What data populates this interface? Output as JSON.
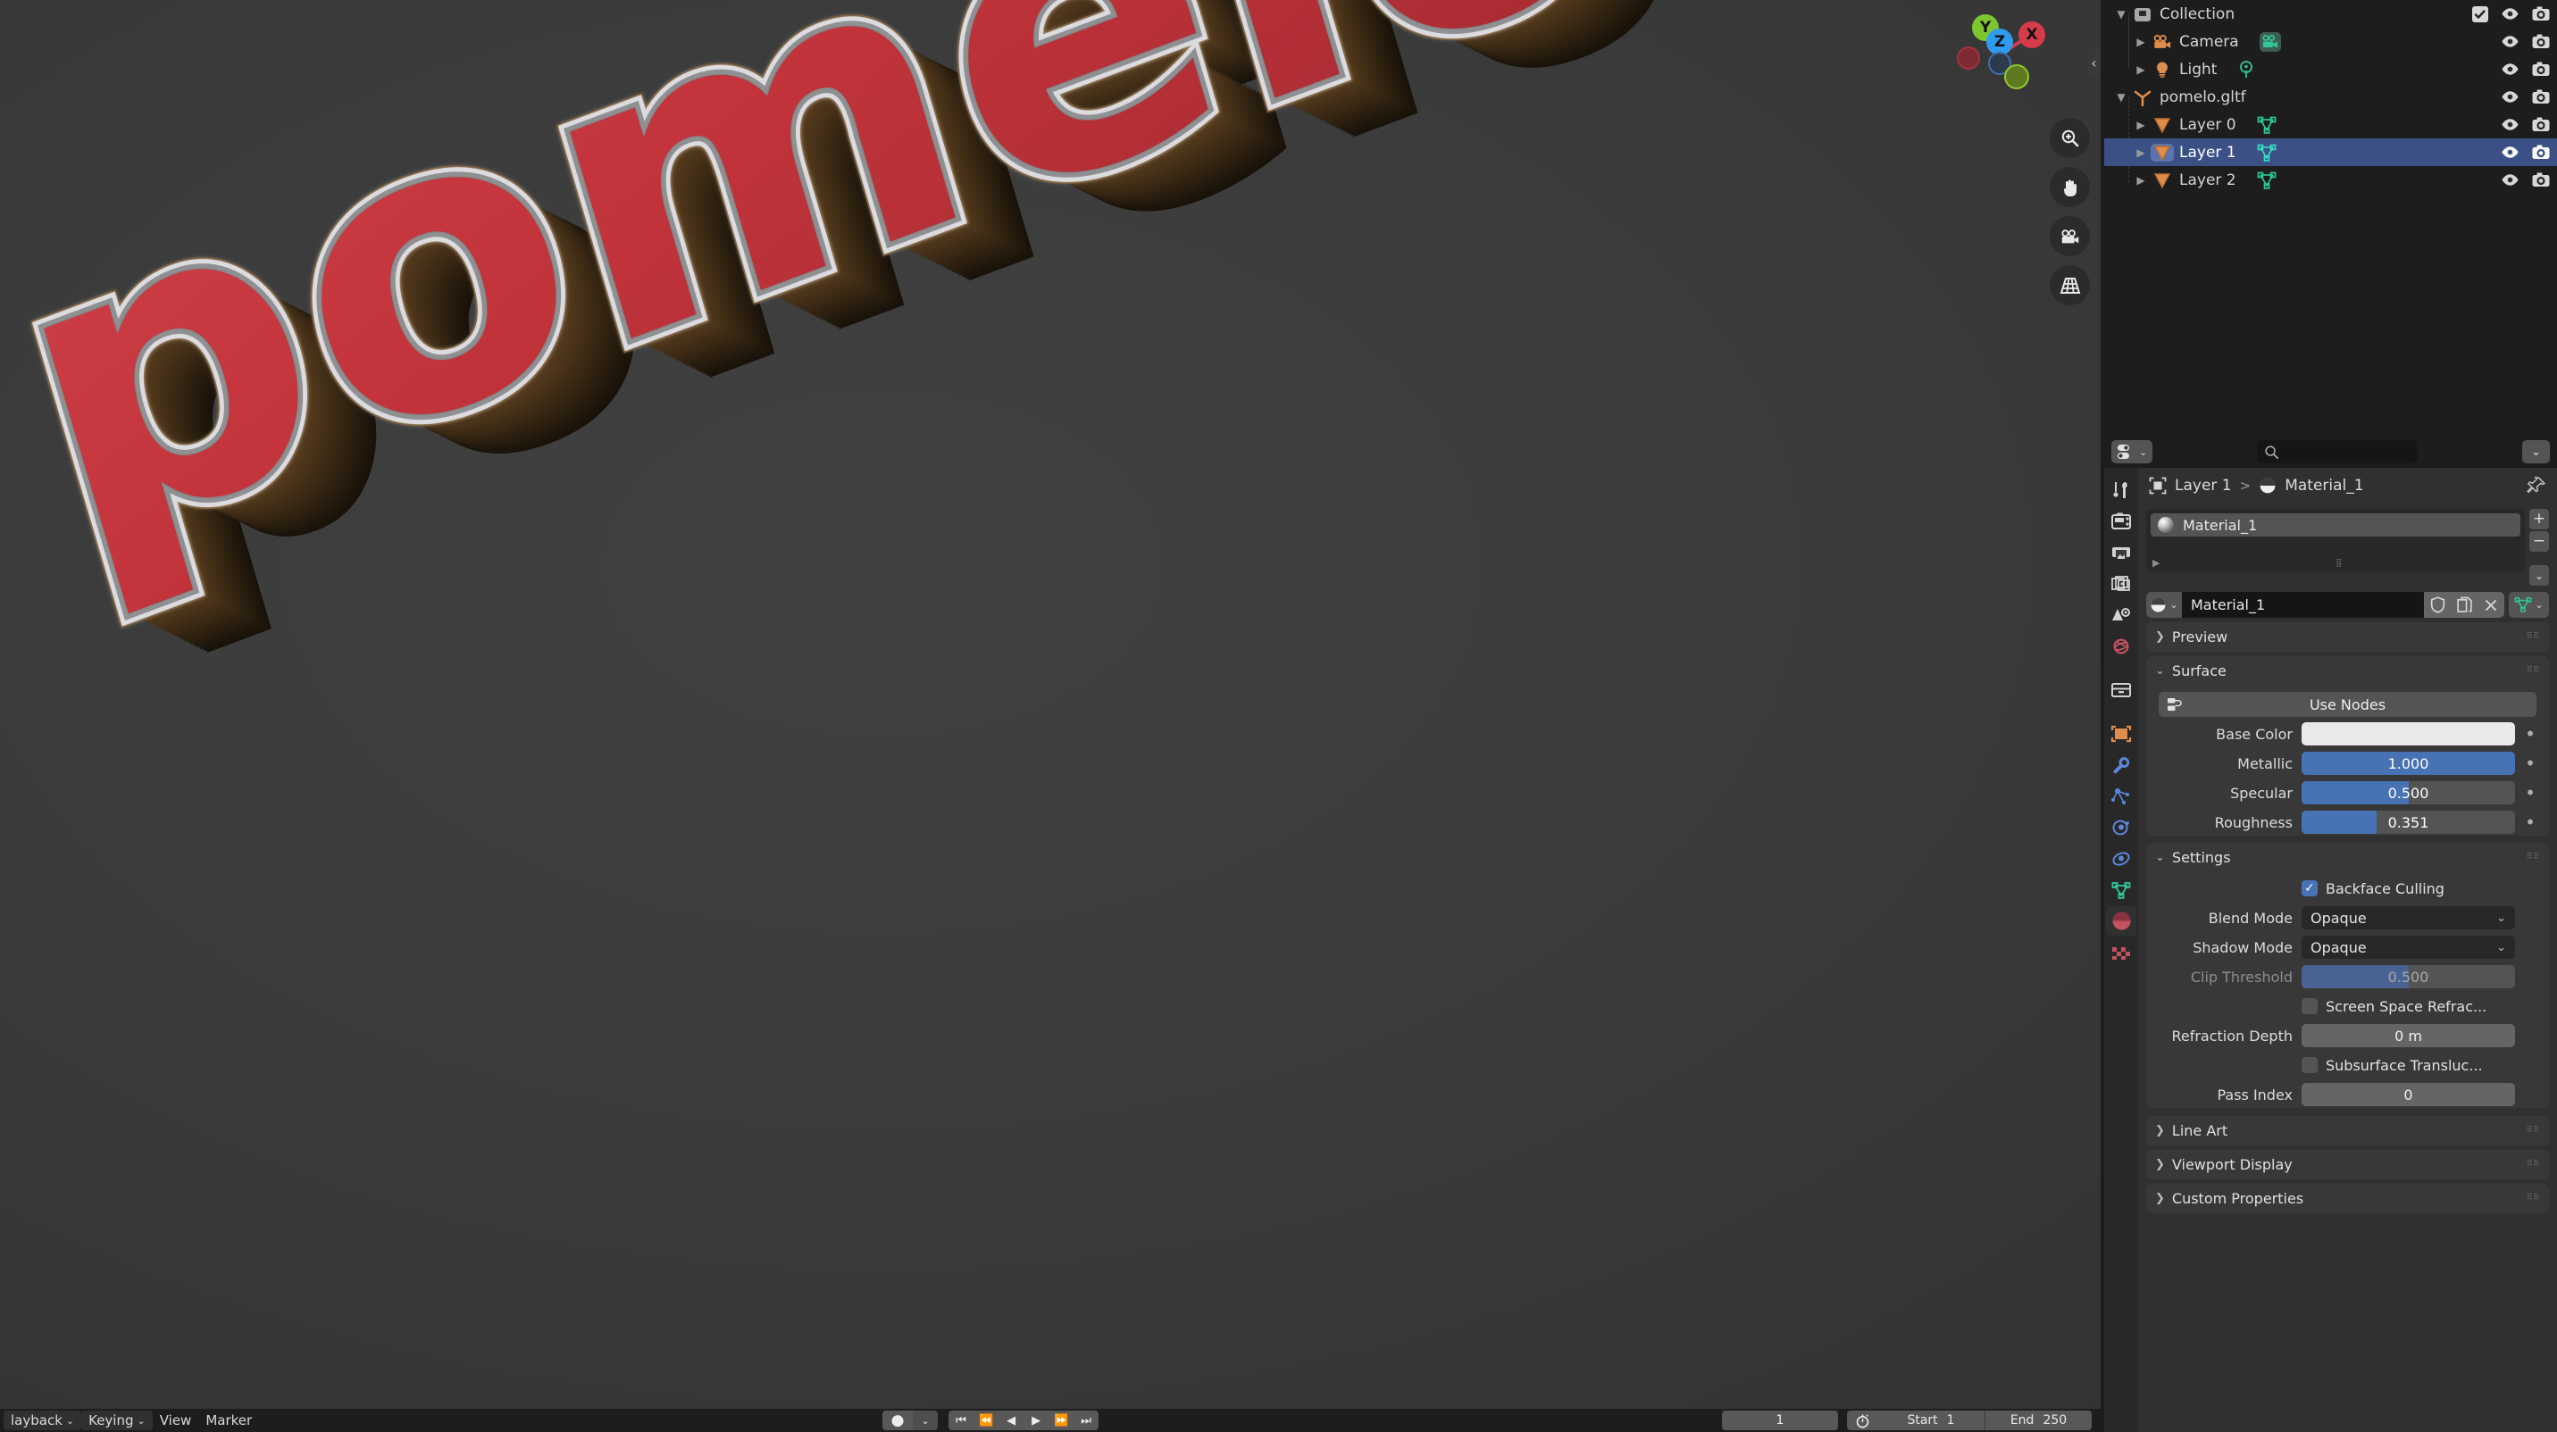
{
  "viewport": {
    "scene_text": "pomelo",
    "gizmo": {
      "axes": [
        {
          "label": "Y",
          "color": "#7dc62f"
        },
        {
          "label": "Z",
          "color": "#2e9bf0"
        },
        {
          "label": "X",
          "color": "#d63b4a"
        }
      ]
    },
    "tools": [
      {
        "name": "zoom-tool",
        "glyph": "zoom-icon"
      },
      {
        "name": "pan-tool",
        "glyph": "hand-icon"
      },
      {
        "name": "camera-tool",
        "glyph": "camera-icon"
      },
      {
        "name": "ortho-persp-tool",
        "glyph": "grid-icon"
      }
    ],
    "sidebar_toggle": "‹"
  },
  "outliner": {
    "rows": [
      {
        "name": "Collection",
        "icon": "collection-icon",
        "depth": 0,
        "expanded": true,
        "selected": false,
        "has_checkbox": true,
        "data_icon": null
      },
      {
        "name": "Camera",
        "icon": "camera-object-icon",
        "depth": 1,
        "expanded": false,
        "selected": false,
        "has_checkbox": false,
        "data_icon": "camera-data-icon"
      },
      {
        "name": "Light",
        "icon": "light-object-icon",
        "depth": 1,
        "expanded": false,
        "selected": false,
        "has_checkbox": false,
        "data_icon": "light-data-icon"
      },
      {
        "name": "pomelo.gltf",
        "icon": "empty-axes-icon",
        "depth": 0,
        "expanded": true,
        "selected": false,
        "has_checkbox": false,
        "data_icon": null
      },
      {
        "name": "Layer 0",
        "icon": "mesh-object-icon",
        "depth": 1,
        "expanded": false,
        "selected": false,
        "has_checkbox": false,
        "data_icon": "mesh-data-icon"
      },
      {
        "name": "Layer 1",
        "icon": "mesh-object-icon",
        "depth": 1,
        "expanded": false,
        "selected": true,
        "has_checkbox": false,
        "data_icon": "mesh-data-icon"
      },
      {
        "name": "Layer 2",
        "icon": "mesh-object-icon",
        "depth": 1,
        "expanded": false,
        "selected": false,
        "has_checkbox": false,
        "data_icon": "mesh-data-icon"
      }
    ],
    "row_toggles": [
      "eye-icon",
      "camera-render-icon"
    ]
  },
  "properties": {
    "header": {
      "editor_type": "properties-editor-icon",
      "search_placeholder": "",
      "options_chevron": "⌄"
    },
    "tabs": [
      {
        "name": "tool",
        "icon": "tool-icon",
        "active": false
      },
      {
        "name": "render",
        "icon": "render-icon",
        "active": false
      },
      {
        "name": "output",
        "icon": "output-printer-icon",
        "active": false
      },
      {
        "name": "view-layer",
        "icon": "view-layer-images-icon",
        "active": false
      },
      {
        "name": "scene",
        "icon": "scene-cone-icon",
        "active": false
      },
      {
        "name": "world",
        "icon": "world-globe-icon",
        "active": false
      },
      {
        "name": "collection",
        "icon": "collection-box-icon",
        "active": false
      },
      {
        "name": "object",
        "icon": "object-square-icon",
        "active": false
      },
      {
        "name": "modifiers",
        "icon": "wrench-icon",
        "active": false
      },
      {
        "name": "particles",
        "icon": "particles-icon",
        "active": false
      },
      {
        "name": "physics",
        "icon": "physics-orbit-icon",
        "active": false
      },
      {
        "name": "constraints",
        "icon": "constraints-icon",
        "active": false
      },
      {
        "name": "object-data",
        "icon": "mesh-data-triangle-icon",
        "active": false
      },
      {
        "name": "material",
        "icon": "material-sphere-icon",
        "active": true
      },
      {
        "name": "texture",
        "icon": "texture-checker-icon",
        "active": false
      }
    ],
    "breadcrumb": {
      "object_icon": "object-icon",
      "object": "Layer 1",
      "separator": ">",
      "material_icon": "material-icon",
      "material": "Material_1",
      "pin_icon": "pin-icon"
    },
    "material_slots": {
      "items": [
        {
          "name": "Material_1",
          "selected": true
        }
      ],
      "add_label": "+",
      "remove_label": "−",
      "menu_label": "⌄",
      "specials_arrow": "▶"
    },
    "material_id": {
      "browse_icon": "material-browse-icon",
      "name": "Material_1",
      "buttons": [
        "shield-fake-user-icon",
        "copy-new-material-icon",
        "unlink-x-icon"
      ],
      "filter_icon": "mesh-filter-icon"
    },
    "panels": {
      "preview": {
        "label": "Preview",
        "expanded": false
      },
      "surface": {
        "label": "Surface",
        "expanded": true
      },
      "settings": {
        "label": "Settings",
        "expanded": true
      },
      "line_art": {
        "label": "Line Art",
        "expanded": false
      },
      "viewport_display": {
        "label": "Viewport Display",
        "expanded": false
      },
      "custom_properties": {
        "label": "Custom Properties",
        "expanded": false
      }
    },
    "surface": {
      "use_nodes_label": "Use Nodes",
      "use_nodes_icon": "nodes-icon",
      "fields": [
        {
          "label": "Base Color",
          "type": "color",
          "value": "#e9e9e9"
        },
        {
          "label": "Metallic",
          "type": "slider",
          "value": "1.000",
          "fill": 100
        },
        {
          "label": "Specular",
          "type": "slider",
          "value": "0.500",
          "fill": 50
        },
        {
          "label": "Roughness",
          "type": "slider",
          "value": "0.351",
          "fill": 35
        }
      ]
    },
    "settings": {
      "backface_culling": {
        "label": "Backface Culling",
        "checked": true
      },
      "blend_mode": {
        "label": "Blend Mode",
        "value": "Opaque"
      },
      "shadow_mode": {
        "label": "Shadow Mode",
        "value": "Opaque"
      },
      "clip_threshold": {
        "label": "Clip Threshold",
        "value": "0.500",
        "fill": 50,
        "disabled": true
      },
      "screen_space_refraction": {
        "label": "Screen Space Refrac...",
        "checked": false
      },
      "refraction_depth": {
        "label": "Refraction Depth",
        "value": "0 m"
      },
      "subsurface_translucency": {
        "label": "Subsurface Transluc...",
        "checked": false
      },
      "pass_index": {
        "label": "Pass Index",
        "value": "0"
      }
    }
  },
  "timeline": {
    "menus": [
      {
        "label": "layback",
        "chevron": "⌄",
        "boxed": true
      },
      {
        "label": "Keying",
        "chevron": "⌄",
        "boxed": true
      },
      {
        "label": "View",
        "chevron": "",
        "boxed": false
      },
      {
        "label": "Marker",
        "chevron": "",
        "boxed": false
      }
    ],
    "record_button": "●",
    "record_chevron": "⌄",
    "transport": [
      "⏮",
      "⏪",
      "◀",
      "▶",
      "⏩",
      "⏭"
    ],
    "current_frame": "1",
    "timer_icon": "stopwatch-icon",
    "start_label": "Start",
    "start_value": "1",
    "end_label": "End",
    "end_value": "250"
  },
  "colors": {
    "accent_blue": "#4772b3",
    "selection_blue": "#3b5185",
    "panel_bg": "#383838",
    "editor_bg": "#303030",
    "header_bg": "#1d1d1d",
    "text_red": "#c8323a",
    "text_brown": "#6a4a22"
  }
}
